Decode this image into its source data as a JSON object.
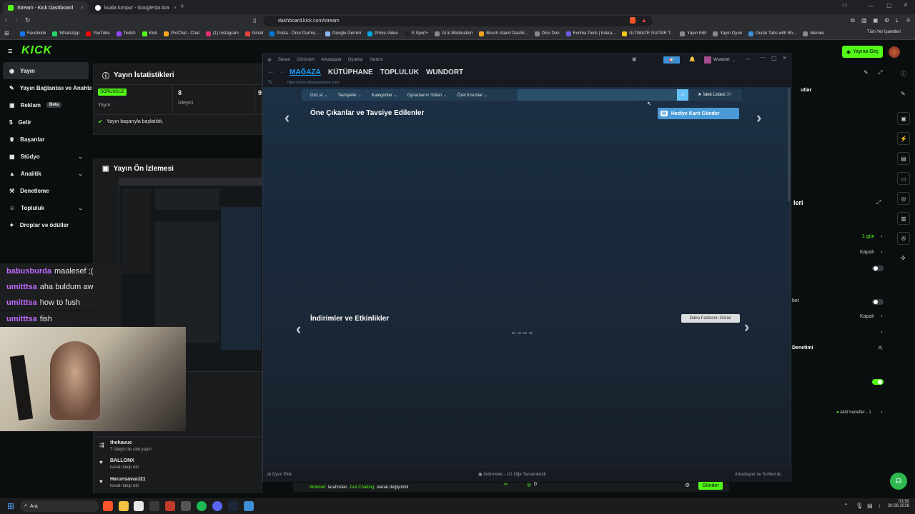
{
  "browser": {
    "tabs": [
      {
        "title": "Stream - Kick Dashboard",
        "active": true
      },
      {
        "title": "kuala lumpur - Google'da Ara",
        "active": false
      }
    ],
    "url": "dashboard.kick.com/stream",
    "bookmarks": [
      "Facebook",
      "WhatsApp",
      "YouTube",
      "Twitch",
      "Kick",
      "ProChat - Chat",
      "(1) Instagram",
      "Gmail",
      "Posta - Onur Durmu...",
      "Google Gemini",
      "Prime Video",
      "S Sport+",
      "AI & Moderation",
      "Bosch Island Dashb...",
      "Dino Den",
      "Evrima Tools | Intera...",
      "ULTIMATE GUITAR T...",
      "Yayın Edit",
      "Yayın Oyun",
      "Guitar Tabs with Rh...",
      "Memes"
    ],
    "all_bookmarks": "Tüm Yer İşaretleri"
  },
  "kick": {
    "logo": "KICK",
    "go_live": "Yayına Geç",
    "nav": [
      {
        "label": "Yayın",
        "active": true
      },
      {
        "label": "Yayın Bağlantısı ve Anahtarı"
      },
      {
        "label": "Reklam",
        "badge": "Beta"
      },
      {
        "label": "Gelir"
      },
      {
        "label": "Başarılar"
      },
      {
        "label": "Stüdyo",
        "chevron": true
      },
      {
        "label": "Analitik",
        "chevron": true
      },
      {
        "label": "Denetleme"
      },
      {
        "label": "Topluluk",
        "chevron": true
      },
      {
        "label": "Droplar ve ödüller"
      }
    ],
    "stats": {
      "title": "Yayın İstatistikleri",
      "status_badge": "SORUNSUZ",
      "status_label": "Yayın",
      "viewers_value": "8",
      "viewers_label": "İzleyici",
      "third_value": "9",
      "success_msg": "Yayın başarıyla başlatıldı."
    },
    "preview_title": "Yayın Ön İzlemesi",
    "chat_overlay": [
      {
        "user": "babusburda",
        "msg": "maalesef ;("
      },
      {
        "user": "umitttsa",
        "msg": "aha buldum aw"
      },
      {
        "user": "umitttsa",
        "msg": "how to fush"
      },
      {
        "user": "umitttsa",
        "msg": "fish"
      }
    ],
    "events": [
      {
        "name": "thehavuc",
        "detail": "7 izleyici ile raid yaptı!"
      },
      {
        "name": "BALLONX",
        "detail": "kanalı takip etti"
      },
      {
        "name": "Harunsavuci21",
        "detail": "kanalı takip etti"
      }
    ],
    "bottom_chat": {
      "who": "Wundort",
      "mid": "tarafından",
      "what": "Just Chatting",
      "end": "olarak değiştirildi",
      "send": "Gönder",
      "count": "0"
    },
    "right": {
      "partial_title": "utlar",
      "section": "leri",
      "val1": "1 gün",
      "val2": "Kapalı",
      "row_bet": "bet",
      "val3": "Kapalı",
      "row_denetim": "Denetimi",
      "goals": "Aktif hedefler - 1"
    }
  },
  "steam": {
    "menu": [
      "Steam",
      "Görünüm",
      "Arkadaşlar",
      "Oyunlar",
      "Yardım"
    ],
    "user": "Wundort",
    "nav": [
      "MAĞAZA",
      "KÜTÜPHANE",
      "TOPLULUK",
      "WUNDORT"
    ],
    "url": "https://store.steampowered.com/",
    "store_menu": [
      "Göz at",
      "Tavsiyeler",
      "Kategoriler",
      "Oynamanın Yolları",
      "Özel Kısımlar"
    ],
    "wishlist": "İstek Listesi",
    "wishlist_count": "30",
    "featured_title": "Öne Çıkanlar ve Tavsiye Edilenler",
    "gift_card": "Hediye Kartı Gönder",
    "deals_title": "İndirimler ve Etkinlikler",
    "see_more": "Daha Fazlasını Görün",
    "add_game": "Oyun Ekle",
    "downloads": "İndirmeler - 1/1 Öğe Tamamlandı",
    "friends_chat": "Arkadaşlar ve Sohbet"
  },
  "taskbar": {
    "search": "Ara",
    "time": "03:50",
    "date": "30.08.2026"
  },
  "colors": {
    "kick_green": "#53fc18",
    "steam_blue": "#1b2838",
    "steam_accent": "#67c1f5"
  }
}
